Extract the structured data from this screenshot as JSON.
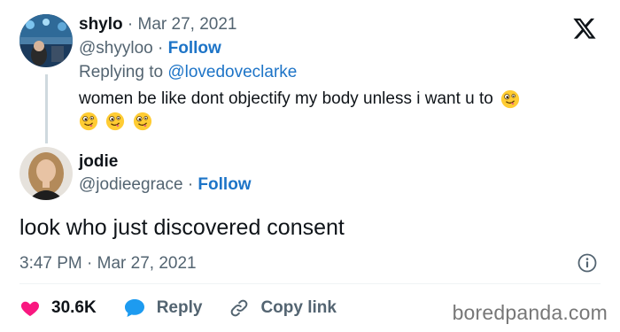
{
  "reply_tweet": {
    "display_name": "shylo",
    "separator": "·",
    "date": "Mar 27, 2021",
    "handle": "@shyyloo",
    "follow_label": "Follow",
    "replying_prefix": "Replying to",
    "replying_to": "@lovedoveclarke",
    "text": "women be like dont objectify my body unless i want u to",
    "emoji": "zany-face"
  },
  "quote_tweet": {
    "display_name": "jodie",
    "handle": "@jodieegrace",
    "separator": "·",
    "follow_label": "Follow",
    "text": "look who just discovered consent",
    "time": "3:47 PM",
    "date": "Mar 27, 2021"
  },
  "actions": {
    "likes": "30.6K",
    "reply_label": "Reply",
    "copy_link_label": "Copy link"
  },
  "watermark": "boredpanda.com",
  "icons": {
    "brand": "x-logo-icon",
    "like": "heart-icon",
    "reply": "speech-bubble-icon",
    "copy": "link-icon",
    "info": "info-icon"
  },
  "colors": {
    "link_blue": "#1d74c7",
    "like_red": "#f91880",
    "reply_blue": "#1d9bf0",
    "muted_gray": "#536471"
  }
}
